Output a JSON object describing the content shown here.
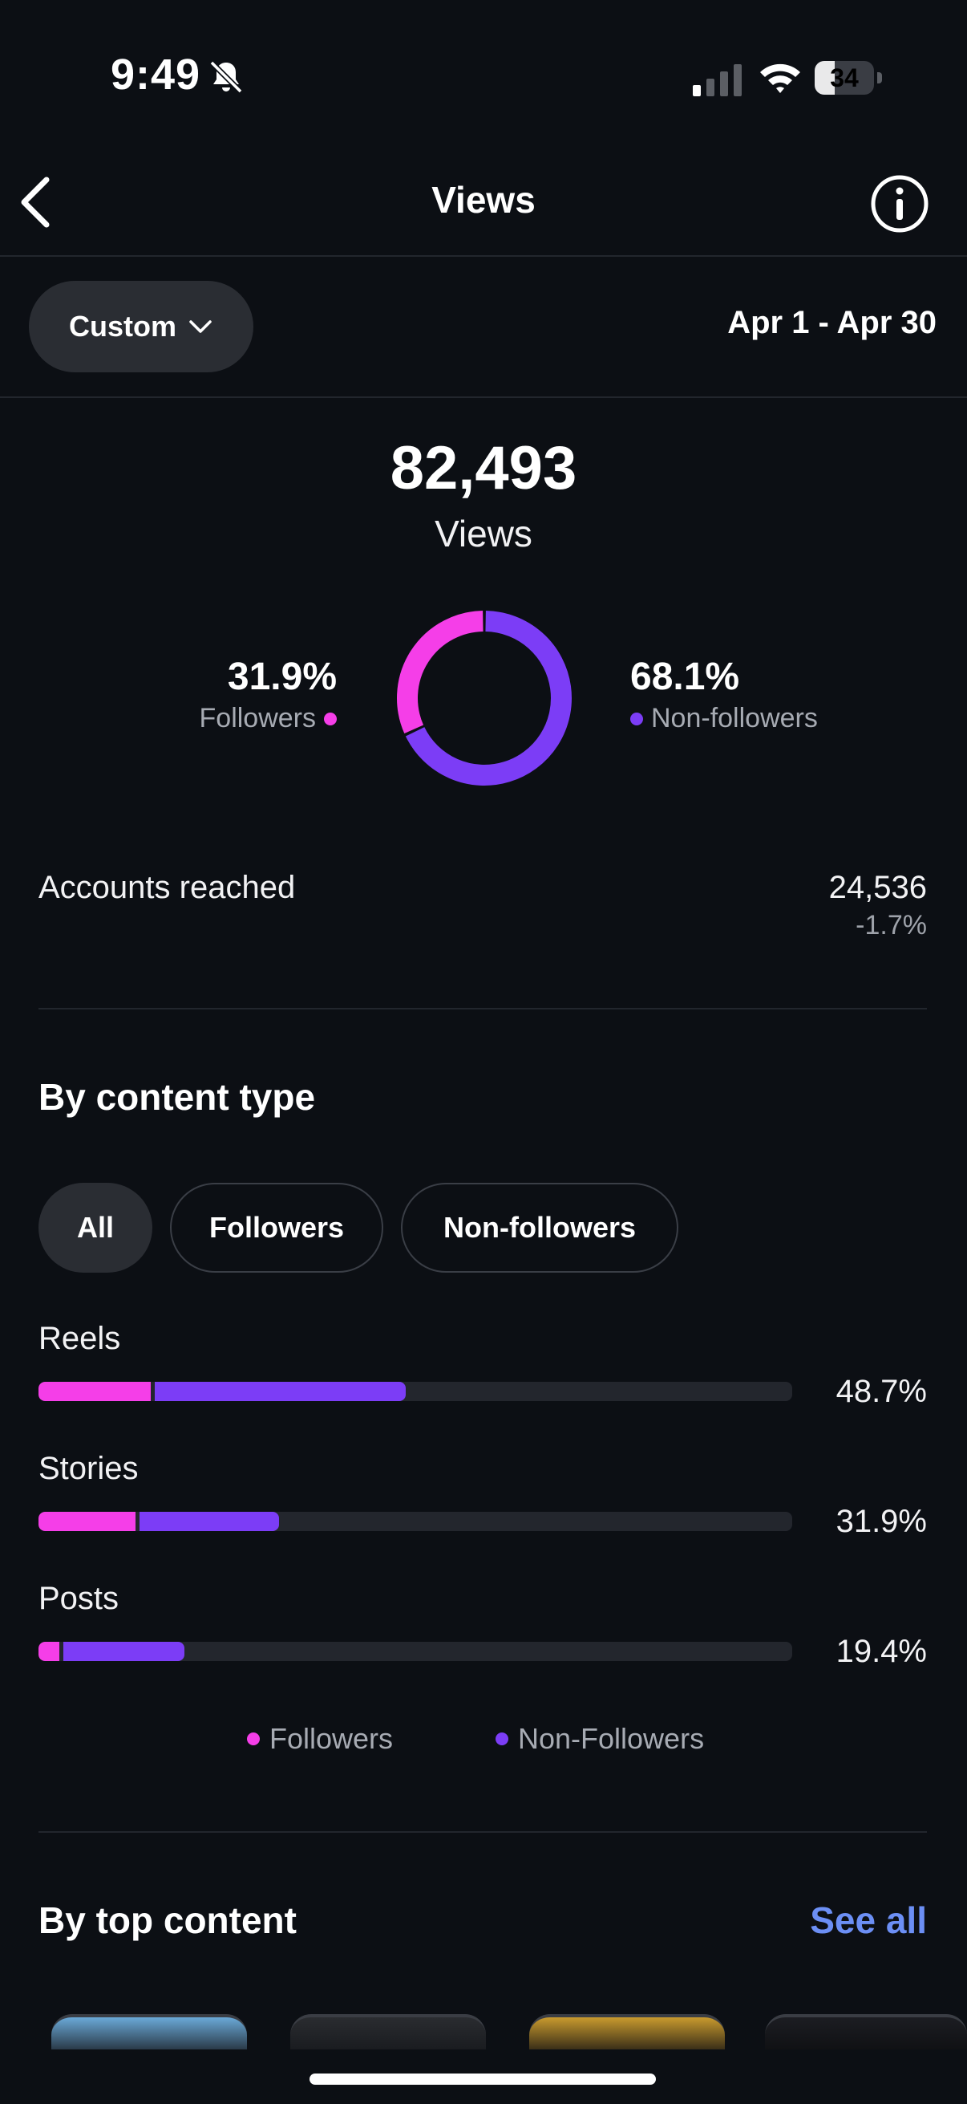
{
  "status_bar": {
    "time": "9:49",
    "battery_level": "34",
    "icons": [
      "bell-slash-icon",
      "cellular-signal-icon",
      "wifi-icon",
      "battery-icon"
    ]
  },
  "nav": {
    "title": "Views",
    "icons": [
      "chevron-left-icon",
      "info-circle-icon"
    ]
  },
  "filter": {
    "range_label": "Custom",
    "date_range": "Apr 1 - Apr 30"
  },
  "summary": {
    "total": "82,493",
    "total_label": "Views",
    "followers_pct": "31.9%",
    "followers_label": "Followers",
    "non_followers_pct": "68.1%",
    "non_followers_label": "Non-followers"
  },
  "reach": {
    "label": "Accounts reached",
    "value": "24,536",
    "change": "-1.7%"
  },
  "by_content_type": {
    "title": "By content type",
    "tabs": [
      "All",
      "Followers",
      "Non-followers"
    ],
    "active_tab": "All",
    "legend": [
      "Followers",
      "Non-Followers"
    ]
  },
  "by_top_content": {
    "title": "By top content",
    "see_all": "See all"
  },
  "colors": {
    "followers": "#f53ee8",
    "non_followers": "#7c3df6",
    "link": "#6c8ff5"
  },
  "chart_data": [
    {
      "type": "pie",
      "title": "Views",
      "labels": [
        "Followers",
        "Non-followers"
      ],
      "values": [
        31.9,
        68.1
      ]
    },
    {
      "type": "bar",
      "title": "By content type",
      "categories": [
        "Reels",
        "Stories",
        "Posts"
      ],
      "totals": [
        48.7,
        31.9,
        19.4
      ],
      "total_labels": [
        "48.7%",
        "31.9%",
        "19.4%"
      ],
      "series": [
        {
          "name": "Followers",
          "values": [
            15.1,
            13.1,
            3.0
          ]
        },
        {
          "name": "Non-Followers",
          "values": [
            33.6,
            18.8,
            16.4
          ]
        }
      ],
      "ylim": [
        0,
        100
      ]
    }
  ]
}
